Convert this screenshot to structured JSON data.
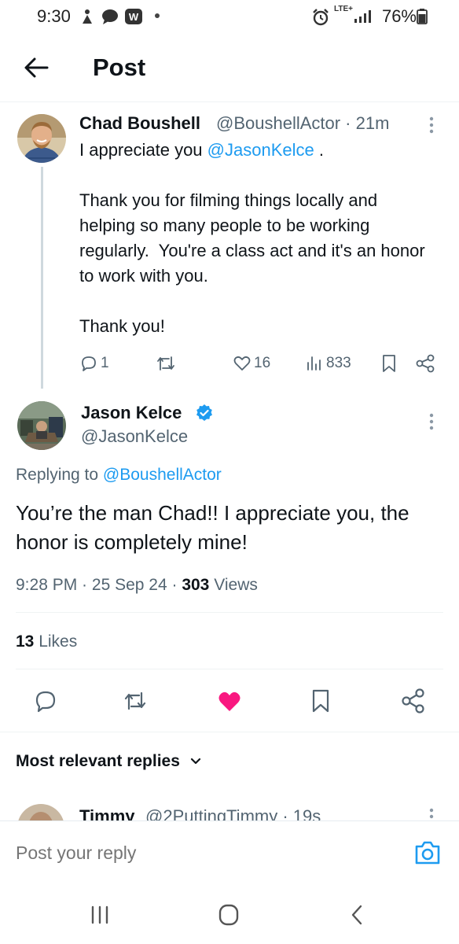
{
  "status_bar": {
    "time": "9:30",
    "network": "LTE+",
    "battery": "76%"
  },
  "header": {
    "title": "Post"
  },
  "reply_tweet": {
    "display_name": "Chad Boushell",
    "handle_time": "@BoushellActor · 21m",
    "text_before_mention": "I appreciate you ",
    "mention": "@JasonKelce",
    "text_after_mention": " .\n\nThank you for filming things locally and helping so many people to be working regularly.  You're a class act and it's an honor to work with you.\n\nThank you!",
    "replies": "1",
    "likes": "16",
    "views": "833"
  },
  "main_tweet": {
    "display_name": "Jason Kelce",
    "handle": "@JasonKelce",
    "replying_to_label": "Replying to ",
    "replying_to_handle": "@BoushellActor",
    "text": "You’re the man Chad!!  I appreciate you, the honor is completely mine!",
    "time": "9:28 PM",
    "date": "25 Sep 24",
    "views_count": "303",
    "views_label": "Views",
    "likes_count": "13",
    "likes_label": "Likes"
  },
  "replies_section": {
    "sort_label": "Most relevant replies"
  },
  "partial_reply": {
    "display_name": "Timmy",
    "handle_time": "@2PuttingTimmy · 19s"
  },
  "compose": {
    "placeholder": "Post your reply"
  },
  "colors": {
    "accent": "#1d9bf0",
    "like_active": "#f91880",
    "secondary_text": "#536471"
  }
}
